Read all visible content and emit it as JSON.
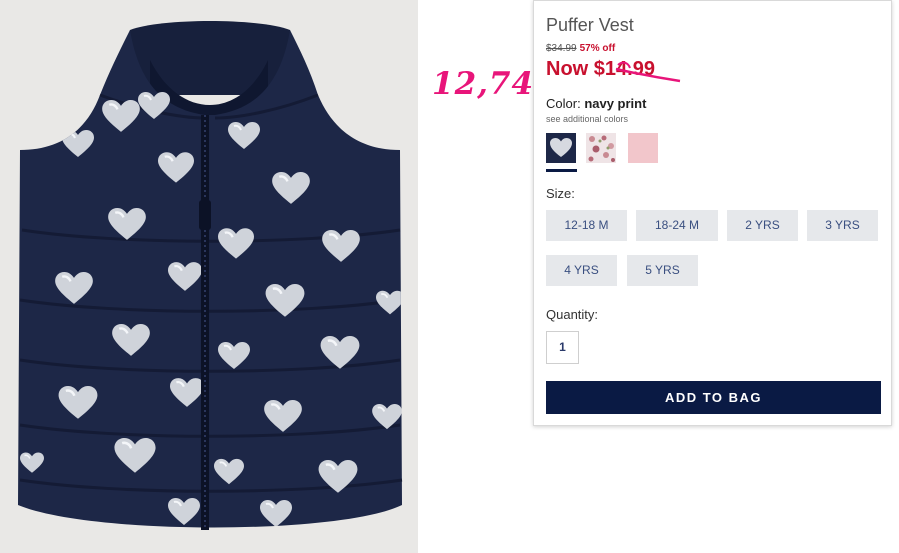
{
  "product": {
    "title": "Puffer Vest",
    "was_price": "$34.99",
    "discount": "57% off",
    "now_price": "Now $14.99"
  },
  "annotation": {
    "text": "12,74",
    "color": "#e8157a"
  },
  "color": {
    "label": "Color:",
    "selected": "navy print",
    "see_additional": "see additional colors",
    "swatches": [
      {
        "name": "navy print",
        "hex": "#1d2747"
      },
      {
        "name": "floral print",
        "hex": "#efe4e6"
      },
      {
        "name": "pink",
        "hex": "#f2c6cb"
      }
    ]
  },
  "size": {
    "label": "Size:",
    "options": [
      "12-18 M",
      "18-24 M",
      "2 YRS",
      "3 YRS",
      "4 YRS",
      "5 YRS"
    ]
  },
  "quantity": {
    "label": "Quantity:",
    "value": "1"
  },
  "add_to_bag": "ADD TO BAG",
  "colors": {
    "accent": "#0a1a44",
    "sale": "#c8102e",
    "vest": "#1d2747"
  }
}
